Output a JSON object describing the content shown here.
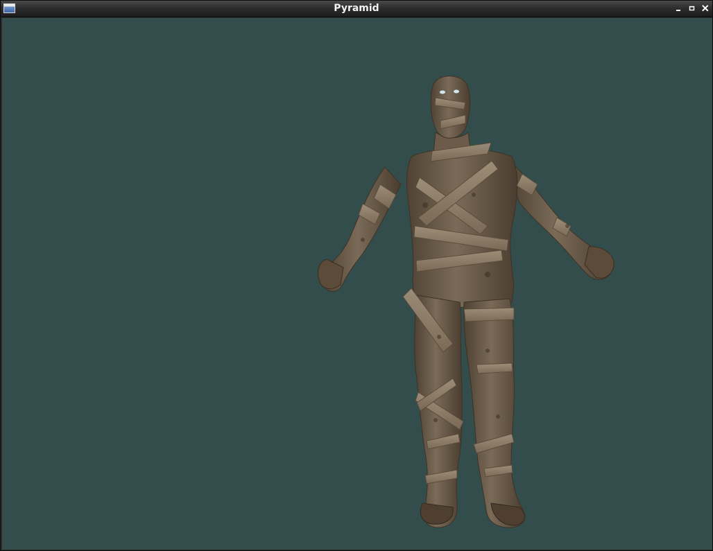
{
  "window": {
    "title": "Pyramid",
    "app_icon": "window-app-icon",
    "controls": {
      "minimize_icon": "minimize-icon",
      "maximize_icon": "maximize-icon",
      "close_icon": "close-icon"
    }
  },
  "viewport": {
    "background_color": "#334d4d",
    "model": "mummy-character-model",
    "bandage_color": "#8a7a66",
    "shadow_color": "#4a3c2e"
  }
}
